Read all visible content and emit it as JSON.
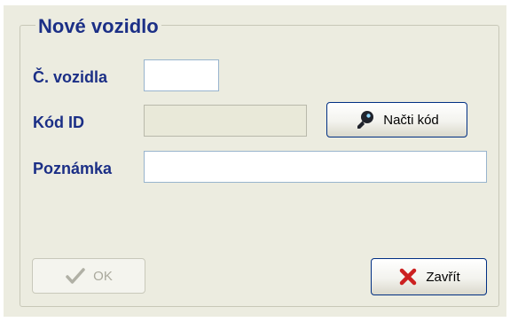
{
  "dialog": {
    "group_title": "Nové vozidlo"
  },
  "fields": {
    "vehicle_number": {
      "label": "Č. vozidla",
      "value": ""
    },
    "id_code": {
      "label": "Kód ID",
      "value": ""
    },
    "note": {
      "label": "Poznámka",
      "value": ""
    }
  },
  "buttons": {
    "read_code": {
      "label": "Načti kód",
      "icon": "key-icon"
    },
    "ok": {
      "label": "OK",
      "icon": "checkmark-icon"
    },
    "close": {
      "label": "Zavřít",
      "icon": "red-x-icon"
    }
  },
  "colors": {
    "background": "#ecece0",
    "label_text": "#1b2f86",
    "button_border": "#002f83",
    "close_icon": "#cc2020"
  }
}
